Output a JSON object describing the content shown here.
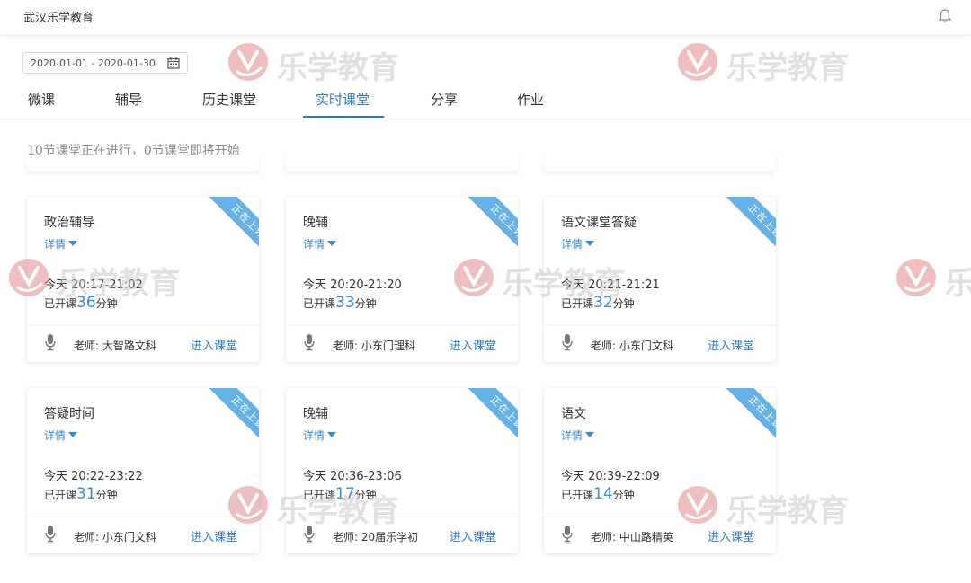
{
  "header": {
    "app_title": "武汉乐学教育",
    "bell_icon": "bell-icon"
  },
  "filters": {
    "date_range": "2020-01-01 - 2020-01-30",
    "calendar_icon": "calendar-icon"
  },
  "tabs": [
    {
      "label": "微课",
      "active": false
    },
    {
      "label": "辅导",
      "active": false
    },
    {
      "label": "历史课堂",
      "active": false
    },
    {
      "label": "实时课堂",
      "active": true
    },
    {
      "label": "分享",
      "active": false
    },
    {
      "label": "作业",
      "active": false
    }
  ],
  "status_line": "10节课堂正在进行，0节课堂即将开始",
  "card_labels": {
    "badge": "正在上课",
    "details": "详情",
    "elapsed_prefix": "已开课",
    "elapsed_suffix": "分钟",
    "enter": "进入课堂",
    "mic_icon": "microphone-icon"
  },
  "cards": [
    {
      "title": "政治辅导",
      "time": "今天 20:17-21:02",
      "minutes": "36",
      "teacher": "老师: 大智路文科"
    },
    {
      "title": "晚辅",
      "time": "今天 20:20-21:20",
      "minutes": "33",
      "teacher": "老师: 小东门理科"
    },
    {
      "title": "语文课堂答疑",
      "time": "今天 20:21-21:21",
      "minutes": "32",
      "teacher": "老师: 小东门文科"
    },
    {
      "title": "答疑时间",
      "time": "今天 20:22-23:22",
      "minutes": "31",
      "teacher": "老师: 小东门文科"
    },
    {
      "title": "晚辅",
      "time": "今天 20:36-23:06",
      "minutes": "17",
      "teacher": "老师: 20届乐学初"
    },
    {
      "title": "语文",
      "time": "今天 20:39-22:09",
      "minutes": "14",
      "teacher": "老师: 中山路精英"
    }
  ],
  "watermark": {
    "text": "乐学教育",
    "logo_icon": "lexue-logo-icon"
  },
  "colors": {
    "accent": "#2b7bc0",
    "badge": "#66b2e6",
    "watermark": "#c9c9c9",
    "logo": "#e38b8b"
  }
}
